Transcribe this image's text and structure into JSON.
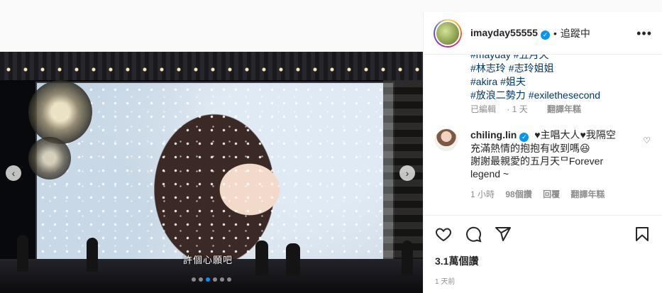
{
  "post": {
    "subtitle": "許個心願吧",
    "carousel_total": 6,
    "carousel_active": 2
  },
  "header": {
    "username": "imayday55555",
    "separator": "•",
    "follow_label": "追蹤中",
    "more_label": "•••"
  },
  "caption": {
    "partial_line": "#mayday #五月天",
    "hashtags": [
      [
        "#林志玲",
        "#志玲姐姐"
      ],
      [
        "#akira",
        "#姐夫"
      ],
      [
        "#放浪二勢力",
        "#exilethesecond"
      ]
    ],
    "edited": "已編輯",
    "time": "1 天",
    "translate": "翻譯年糕"
  },
  "comment": {
    "username": "chiling.lin",
    "line1": "♥主唱大人♥我隔空",
    "line2": "充滿熱情的抱抱有收到嗎😆",
    "line3": "謝謝最親愛的五月天ᄆForever",
    "line4": "legend ~",
    "time": "1 小時",
    "likes": "98個讚",
    "reply": "回覆",
    "translate": "翻譯年糕"
  },
  "stats": {
    "views": "3.1萬個讚",
    "date": "1 天前"
  },
  "colors": {
    "link": "#00376b",
    "verified": "#0095f6",
    "muted": "#8e8e8e"
  }
}
